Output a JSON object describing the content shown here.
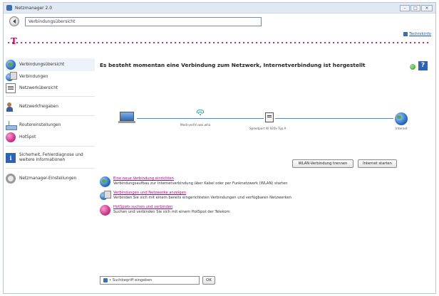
{
  "window": {
    "title": "Netzmanager 2.0",
    "controls": [
      "–",
      "□",
      "✕"
    ]
  },
  "address": {
    "value": "Verbindungsübersicht"
  },
  "header": {
    "tech_info": "Technikinfo"
  },
  "sidebar": {
    "items": [
      {
        "label": "Verbindungsübersicht",
        "icon": "globe-icon"
      },
      {
        "label": "Verbindungen",
        "icon": "connections-icon"
      },
      {
        "label": "Netzwerkübersicht",
        "icon": "network-doc-icon"
      },
      {
        "label": "Netzwerkfreigaben",
        "icon": "person-share-icon"
      },
      {
        "label": "Routereinstellungen",
        "icon": "router-icon"
      },
      {
        "label": "HotSpot",
        "icon": "hotspot-icon"
      },
      {
        "label": "Sicherheit, Fehlerdiagnose und weitere Informationen",
        "icon": "info-icon"
      },
      {
        "label": "Netzmanager-Einstellungen",
        "icon": "gear-icon"
      }
    ]
  },
  "main": {
    "status": "Es besteht momentan eine Verbindung zum Netzwerk, Internetverbindung ist hergestellt",
    "diagram": {
      "wlan_label": "Medi-verfm.wei.wha",
      "router_label": "Speedport W 920v Typ A",
      "internet_label": "Internet"
    },
    "buttons": {
      "disconnect": "WLAN-Verbindung trennen",
      "start_internet": "Internet starten"
    },
    "tasks": [
      {
        "title": "Eine neue Verbindung einrichten",
        "desc": "Verbindungsaufbau zur Internetverbindung über Kabel oder per Funknetzwerk (WLAN) starten",
        "icon": "globe-icon"
      },
      {
        "title": "Verbindungen und Netzwerke anzeigen",
        "desc": "Verbinden Sie sich mit einem bereits eingerichteten Verbindungen und verfügbaren Netzwerken",
        "icon": "connections-icon"
      },
      {
        "title": "HotSpots suchen und verbinden",
        "desc": "Suchen und verbinden Sie sich mit einem HotSpot der Telekom",
        "icon": "hotspot-icon"
      }
    ],
    "search": {
      "value": "• Suchbegriff eingeben",
      "ok": "OK"
    }
  },
  "colors": {
    "brand": "#d6006f",
    "link": "#c0007a",
    "accent": "#2b63b8"
  }
}
